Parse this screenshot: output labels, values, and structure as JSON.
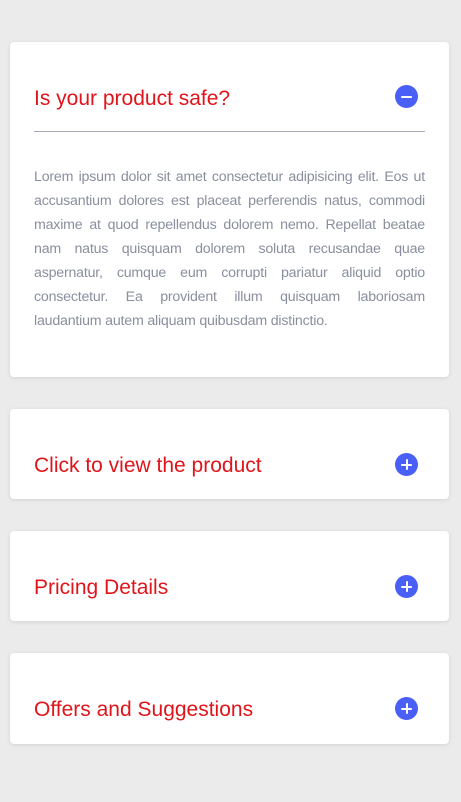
{
  "colors": {
    "background": "#ebebeb",
    "card": "#ffffff",
    "title": "#e0151b",
    "toggle": "#4a5ff5",
    "body_text": "#8a8f9e",
    "divider": "#a9abbd"
  },
  "accordion": {
    "items": [
      {
        "title": "Is your product safe?",
        "expanded": true,
        "toggle_icon": "minus-circle-icon",
        "body": "Lorem ipsum dolor sit amet consectetur adipisicing elit. Eos ut accusantium dolores est placeat perferendis natus, commodi maxime at quod repellendus dolorem nemo. Repellat beatae nam natus quisquam dolorem soluta recusandae quae aspernatur, cumque eum corrupti pariatur aliquid optio consectetur. Ea provident illum quisquam laboriosam laudantium autem aliquam quibusdam distinctio."
      },
      {
        "title": "Click to view the product",
        "expanded": false,
        "toggle_icon": "plus-circle-icon"
      },
      {
        "title": "Pricing Details",
        "expanded": false,
        "toggle_icon": "plus-circle-icon"
      },
      {
        "title": "Offers and Suggestions",
        "expanded": false,
        "toggle_icon": "plus-circle-icon"
      }
    ]
  }
}
